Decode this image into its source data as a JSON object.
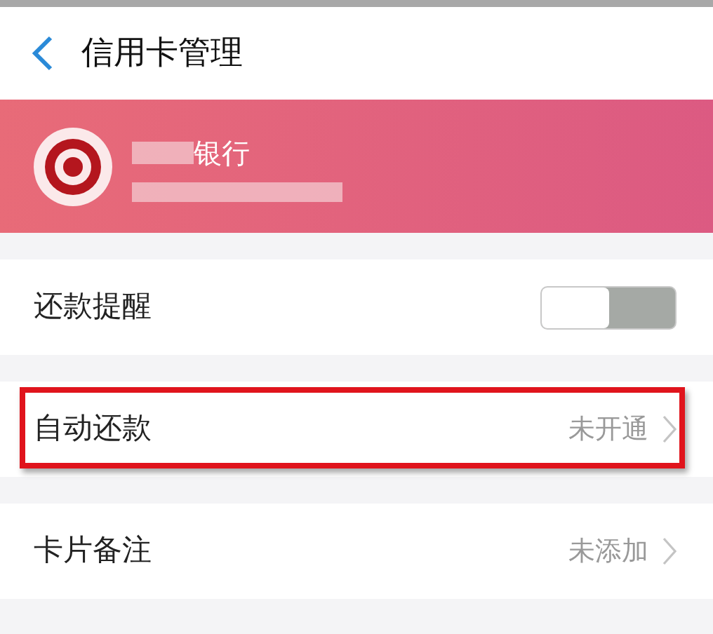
{
  "header": {
    "title": "信用卡管理"
  },
  "card": {
    "bank_name": "银行"
  },
  "rows": [
    {
      "kind": "toggle",
      "label": "还款提醒",
      "on": false,
      "highlighted": false
    },
    {
      "kind": "link",
      "label": "自动还款",
      "value": "未开通",
      "highlighted": true
    },
    {
      "kind": "link",
      "label": "卡片备注",
      "value": "未添加",
      "highlighted": false
    }
  ]
}
